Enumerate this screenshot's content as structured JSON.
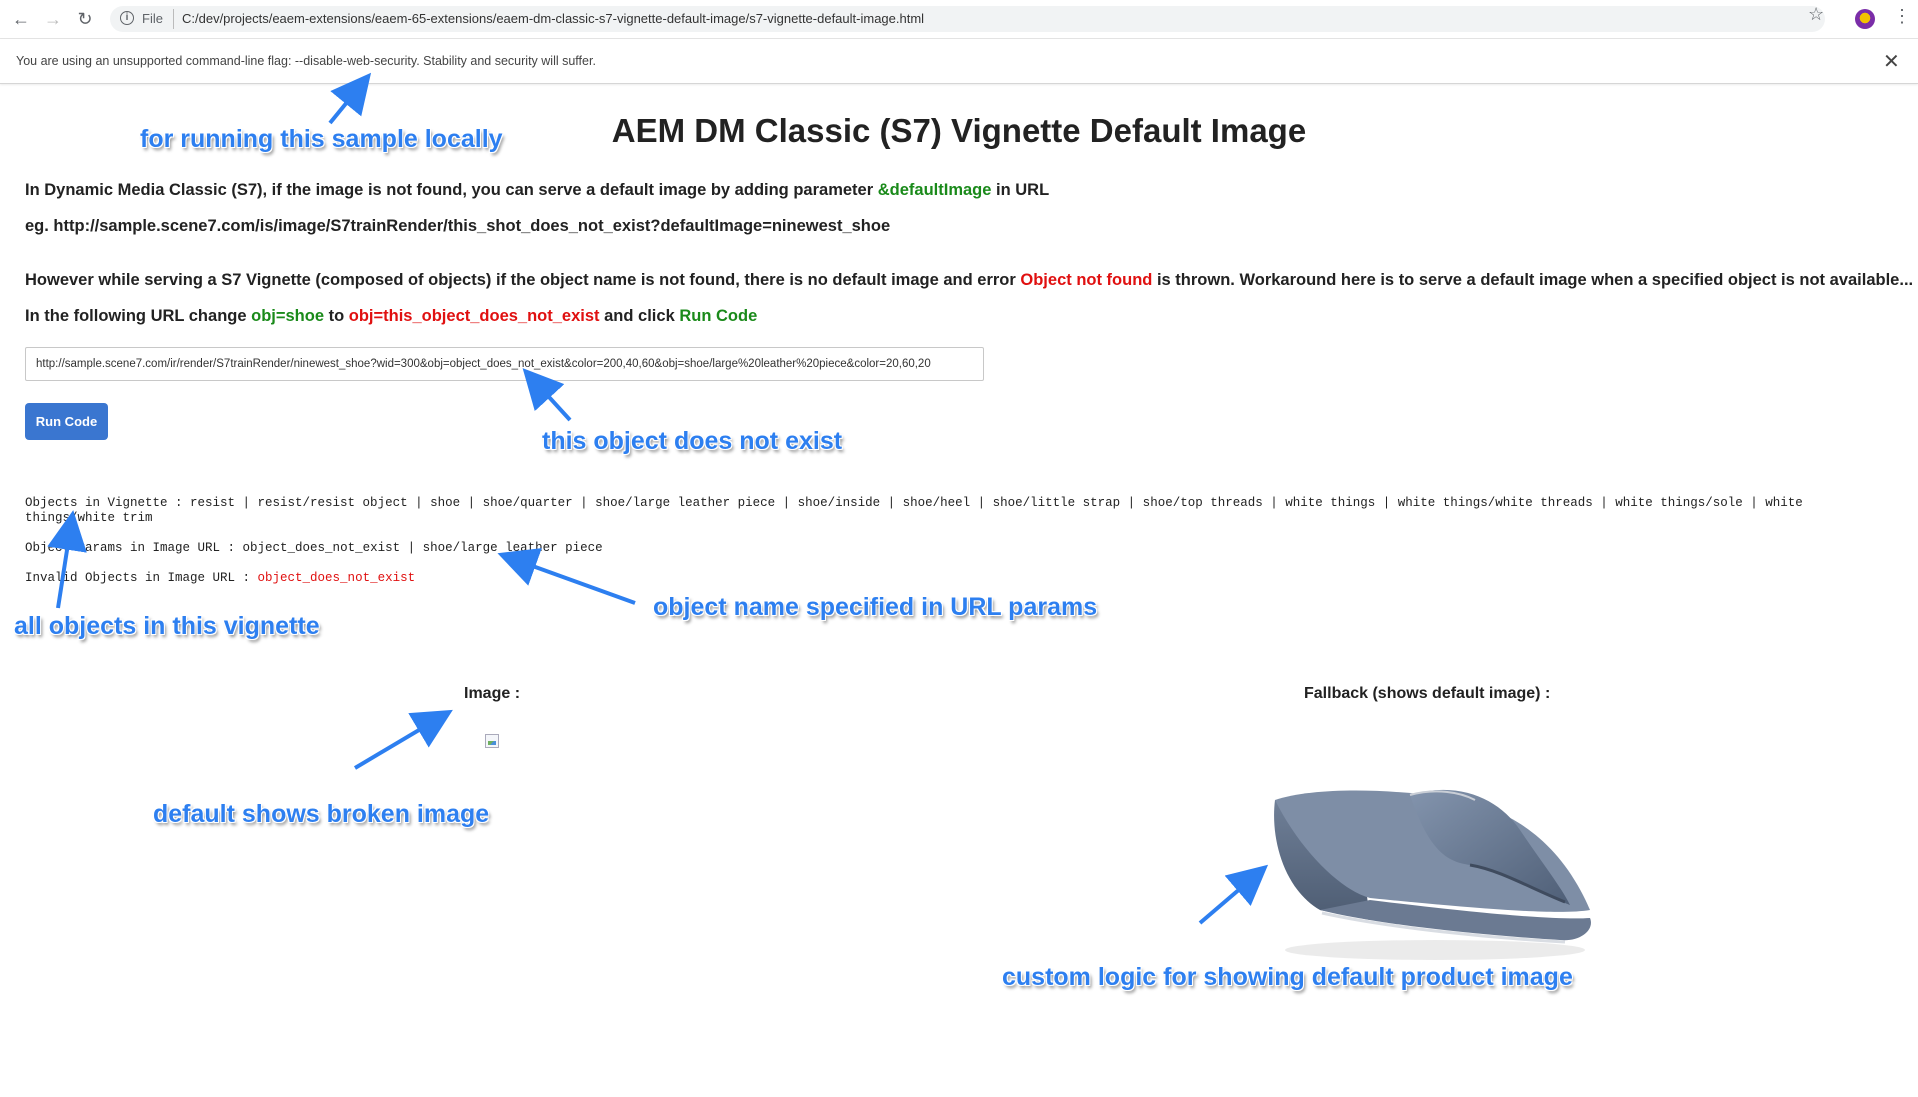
{
  "browser": {
    "scheme_label": "File",
    "url": "C:/dev/projects/eaem-extensions/eaem-65-extensions/eaem-dm-classic-s7-vignette-default-image/s7-vignette-default-image.html",
    "infobar_text": "You are using an unsupported command-line flag: --disable-web-security. Stability and security will suffer."
  },
  "page": {
    "title": "AEM DM Classic (S7) Vignette Default Image",
    "para1": {
      "pre": "In Dynamic Media Classic (S7), if the image is not found, you can serve a default image by adding parameter ",
      "param": "&defaultImage",
      "post": " in URL"
    },
    "para2": "eg. http://sample.scene7.com/is/image/S7trainRender/this_shot_does_not_exist?defaultImage=ninewest_shoe",
    "para3": {
      "pre": "However while serving a S7 Vignette (composed of objects) if the object name is not found, there is no default image and error ",
      "error": "Object not found",
      "post": " is thrown. Workaround here is to serve a default image when a specified object is not available..."
    },
    "para4": {
      "pre": "In the following URL change ",
      "from": "obj=shoe",
      "mid": " to ",
      "to": "obj=this_object_does_not_exist",
      "mid2": " and click ",
      "action": "Run Code"
    },
    "url_value": "http://sample.scene7.com/ir/render/S7trainRender/ninewest_shoe?wid=300&obj=object_does_not_exist&color=200,40,60&obj=shoe/large%20leather%20piece&color=20,60,20",
    "run_button": "Run Code",
    "objects_label": "Objects in Vignette : ",
    "objects_value": "resist | resist/resist object | shoe | shoe/quarter | shoe/large leather piece | shoe/inside | shoe/heel | shoe/little strap | shoe/top threads | white things | white things/white threads | white things/sole | white things/white trim",
    "params_label": "Object Params in Image URL : ",
    "params_value": "object_does_not_exist | shoe/large leather piece",
    "invalid_label": "Invalid Objects in Image URL : ",
    "invalid_value": "object_does_not_exist",
    "image_heading": "Image :",
    "fallback_heading": "Fallback (shows default image) :"
  },
  "annotations": {
    "a1": "for running this sample locally",
    "a2": "this object does not exist",
    "a3": "object name specified in URL params",
    "a4": "all objects in this vignette",
    "a5": "default shows broken image",
    "a6": "custom logic for showing default product image"
  },
  "colors": {
    "accent_green": "#1a8a1a",
    "error_red": "#e01010",
    "button_blue": "#3a76d0",
    "annotation_blue": "#2d7ff0"
  }
}
